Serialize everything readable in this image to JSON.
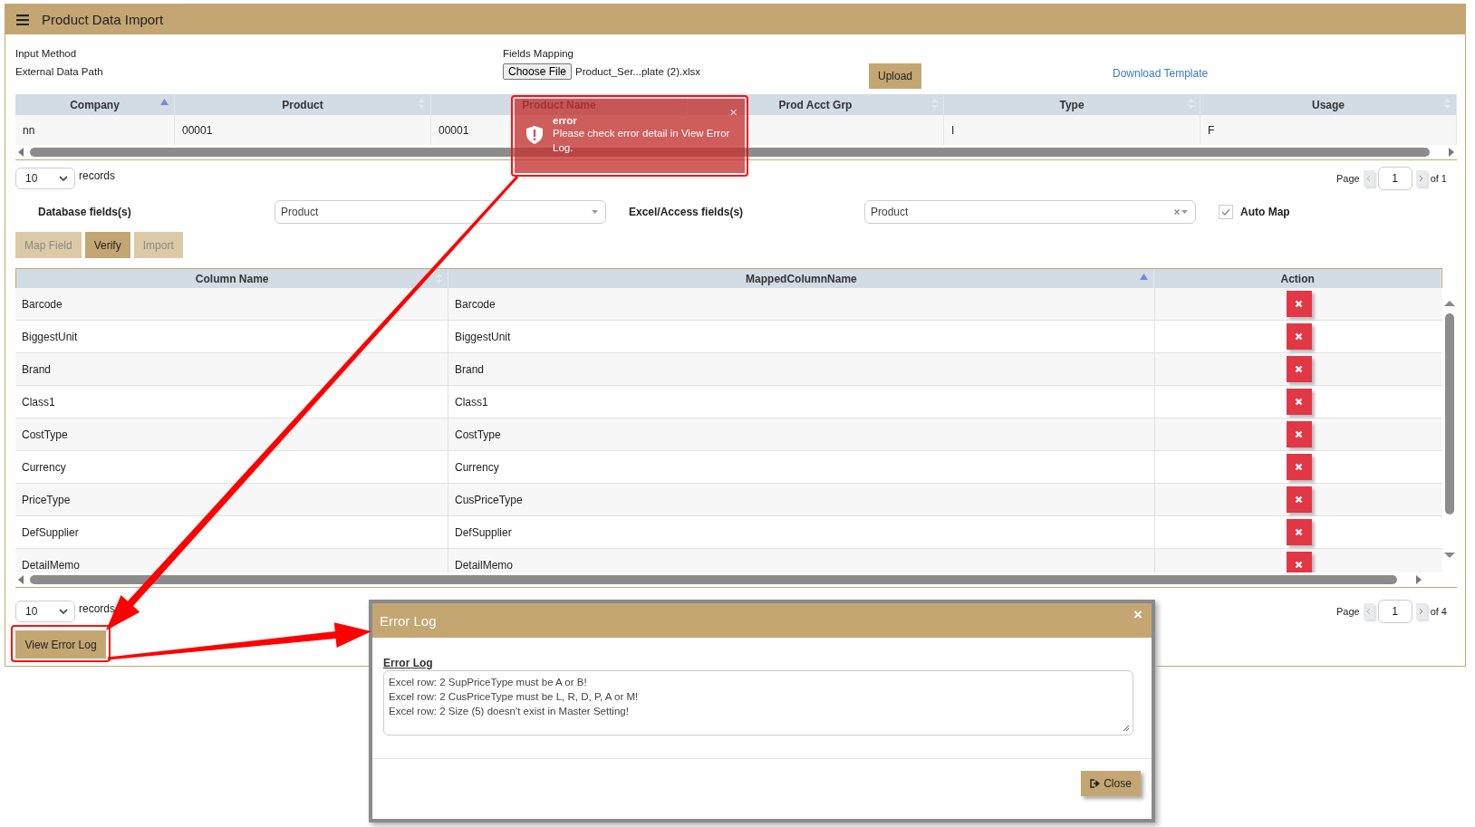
{
  "header": {
    "title": "Product Data Import"
  },
  "input": {
    "input_method_label": "Input Method",
    "external_path_label": "External Data Path",
    "fields_mapping_label": "Fields Mapping",
    "choose_file": "Choose File",
    "file_name": "Product_Ser...plate (2).xlsx",
    "upload": "Upload",
    "download_template": "Download Template"
  },
  "preview_table": {
    "columns": [
      {
        "label": "Company",
        "sorted": true
      },
      {
        "label": "Product",
        "sorted": false
      },
      {
        "label": "Product Name"
      },
      {
        "label": "Prod Acct Grp",
        "sorted": false
      },
      {
        "label": "Type",
        "sorted": false
      },
      {
        "label": "Usage",
        "sorted": false
      }
    ],
    "rows": [
      [
        "nn",
        "00001",
        "00001",
        null,
        "I",
        "F"
      ]
    ]
  },
  "preview_pager": {
    "page_size": "10",
    "records_label": "records",
    "page_label": "Page",
    "page": "1",
    "total": "of 1"
  },
  "mapping": {
    "database_label": "Database fields(s)",
    "database_value": "Product",
    "excel_label": "Excel/Access fields(s)",
    "excel_value": "Product",
    "auto_map": {
      "label": "Auto Map",
      "checked": true
    }
  },
  "actions": [
    {
      "label": "Map Field",
      "disabled": true
    },
    {
      "label": "Verify",
      "disabled": false
    },
    {
      "label": "Import",
      "disabled": true
    }
  ],
  "mapping_table": {
    "columns": [
      {
        "label": "Column Name",
        "sorted": false
      },
      {
        "label": "MappedColumnName",
        "sorted": true
      },
      {
        "label": "Action"
      }
    ],
    "rows": [
      [
        "Barcode",
        "Barcode"
      ],
      [
        "BiggestUnit",
        "BiggestUnit"
      ],
      [
        "Brand",
        "Brand"
      ],
      [
        "Class1",
        "Class1"
      ],
      [
        "CostType",
        "CostType"
      ],
      [
        "Currency",
        "Currency"
      ],
      [
        "PriceType",
        "CusPriceType"
      ],
      [
        "DefSupplier",
        "DefSupplier"
      ],
      [
        "DetailMemo",
        "DetailMemo"
      ]
    ]
  },
  "mapping_pager": {
    "page_size": "10",
    "records_label": "records",
    "page_label": "Page",
    "page": "1",
    "total": "of 4"
  },
  "view_error_log": "View Error Log",
  "toast": {
    "title": "error",
    "message": "Please check error detail in View Error Log.",
    "close": "×"
  },
  "dialog": {
    "title": "Error Log",
    "close": "×",
    "field_label": "Error Log",
    "log_lines": [
      "Excel row: 2 SupPriceType must be A or B!",
      "Excel row: 2 CusPriceType must be L, R, D, P, A or M!",
      "Excel row: 2 Size (5) doesn't exist in Master Setting!"
    ],
    "close_button": "Close"
  }
}
